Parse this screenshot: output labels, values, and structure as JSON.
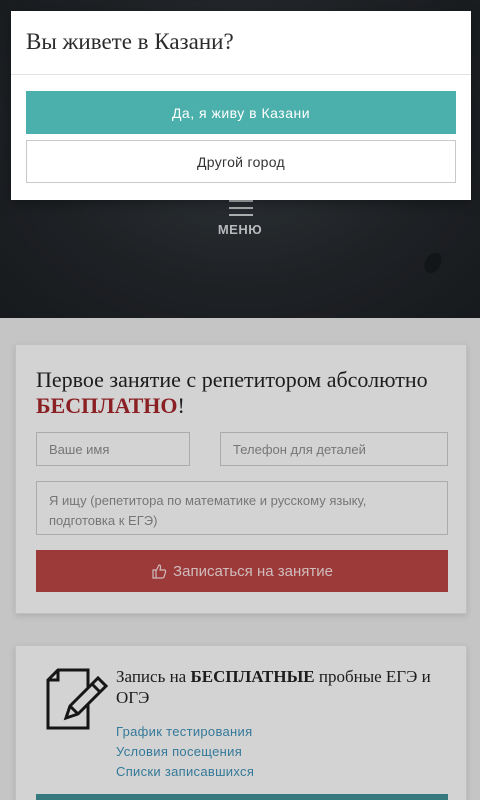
{
  "modal": {
    "question": "Вы живете в Казани?",
    "confirm_label": "Да, я живу в Казани",
    "other_label": "Другой город"
  },
  "header": {
    "menu_label": "МЕНЮ"
  },
  "form": {
    "title_part1": "Первое занятие с репетитором абсолютно ",
    "title_accent": "БЕСПЛАТНО",
    "title_end": "!",
    "name_placeholder": "Ваше имя",
    "phone_placeholder": "Телефон для деталей",
    "request_placeholder": "Я ищу (репетитора по математике и русскому языку, подготовка к ЕГЭ)",
    "submit_label": "Записаться на занятие"
  },
  "info": {
    "title_part1": "Запись на ",
    "title_bold": "БЕСПЛАТНЫЕ",
    "title_part2": " пробные ЕГЭ и ОГЭ",
    "links": [
      "График тестирования",
      "Условия посещения",
      "Списки записавшихся"
    ]
  },
  "colors": {
    "accent_teal": "#4bafab",
    "accent_red": "#b64343",
    "link_blue": "#3d8db3"
  }
}
